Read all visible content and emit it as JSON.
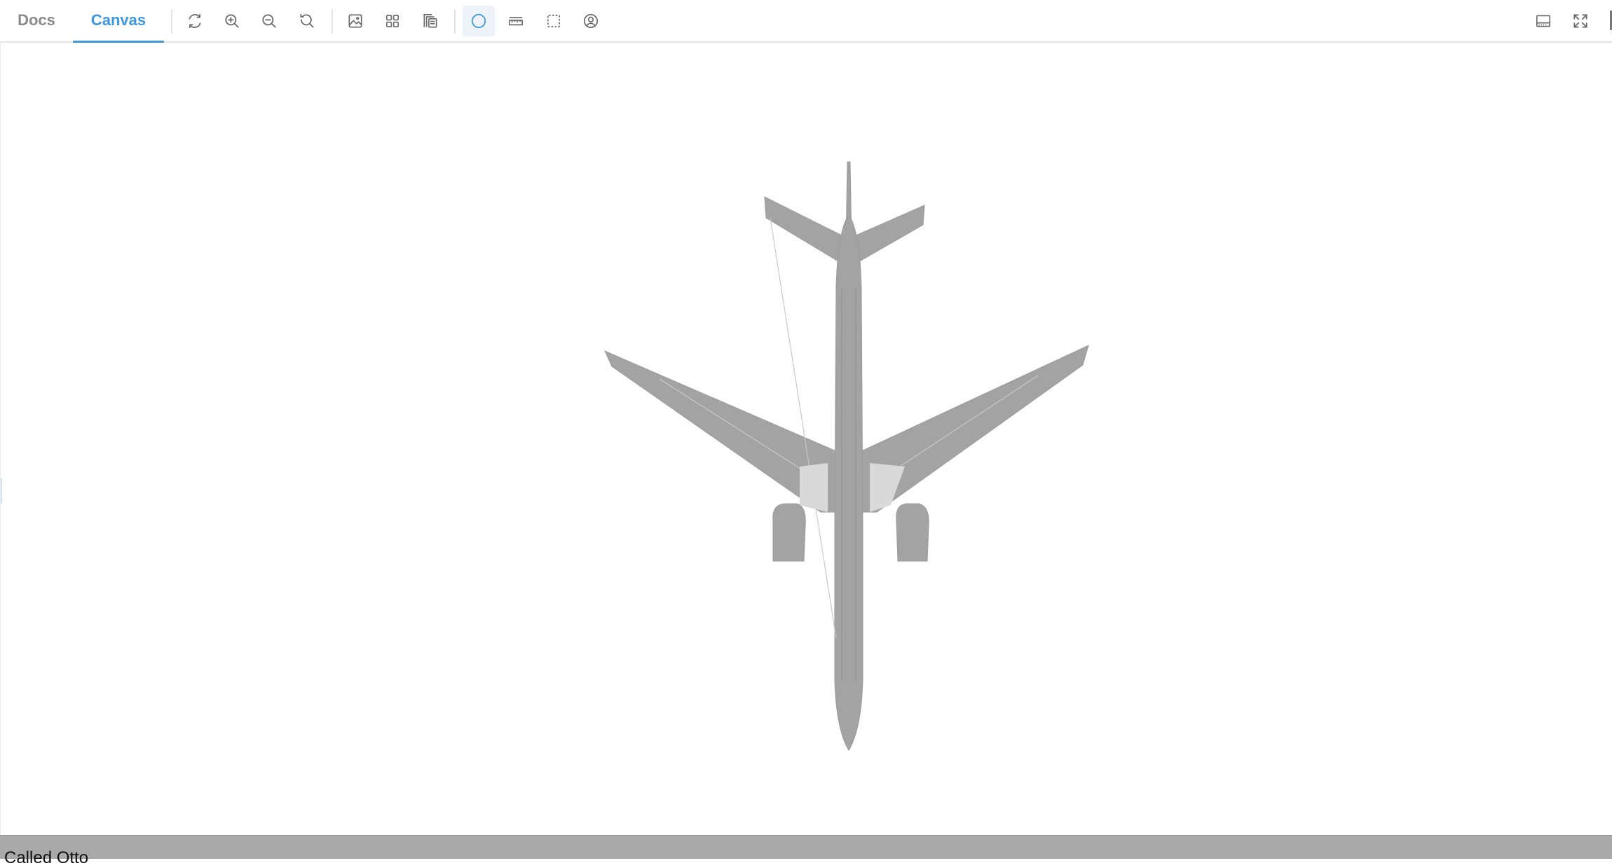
{
  "tabs": [
    {
      "label": "Docs",
      "active": false
    },
    {
      "label": "Canvas",
      "active": true
    }
  ],
  "toolbar": {
    "view_group": [
      "refresh-icon",
      "zoom-in-icon",
      "zoom-out-icon",
      "zoom-reset-icon"
    ],
    "layout_group": [
      "image-icon",
      "grid-icon",
      "stack-icon"
    ],
    "tool_group": [
      "circle-icon",
      "ruler-icon",
      "select-region-icon",
      "user-circle-icon"
    ],
    "active_tool": "circle-icon",
    "right_group": [
      "panel-bottom-icon",
      "fullscreen-icon"
    ]
  },
  "canvas": {
    "content": "aircraft-top-view-image"
  },
  "status": {
    "text": "Called Otto"
  },
  "colors": {
    "accent": "#3d97e0",
    "inactive_tab": "#8a8a8a",
    "statusbar": "#a9a9a9",
    "model": "#a3a3a3"
  }
}
